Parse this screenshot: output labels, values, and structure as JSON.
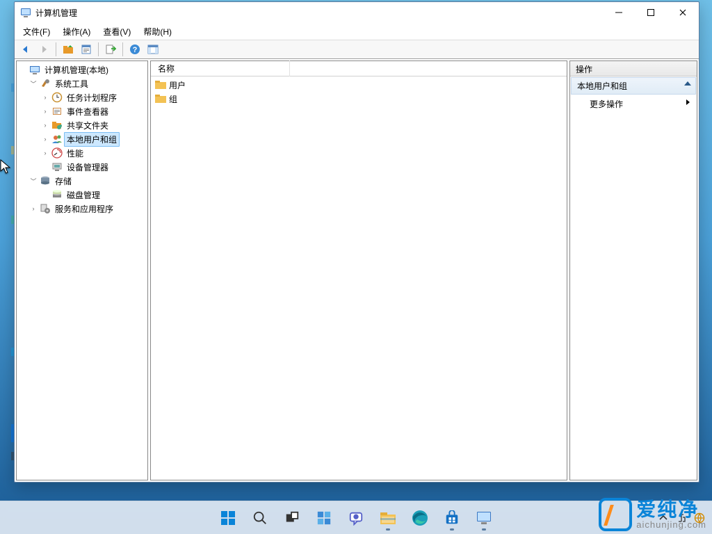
{
  "window": {
    "title": "计算机管理",
    "menus": {
      "file": "文件(F)",
      "action": "操作(A)",
      "view": "查看(V)",
      "help": "帮助(H)"
    }
  },
  "winctrl": {
    "min": "—",
    "max": "☐",
    "close": "✕"
  },
  "toolbar": {
    "back": "back",
    "fwd": "forward",
    "up": "up-folder",
    "props": "properties",
    "export": "export",
    "help": "help",
    "showhide": "showhide"
  },
  "tree": {
    "root": "计算机管理(本地)",
    "system_tools": "系统工具",
    "task_scheduler": "任务计划程序",
    "event_viewer": "事件查看器",
    "shared_folders": "共享文件夹",
    "local_users_groups": "本地用户和组",
    "performance": "性能",
    "device_manager": "设备管理器",
    "storage": "存储",
    "disk_mgmt": "磁盘管理",
    "services_apps": "服务和应用程序"
  },
  "content": {
    "column_name": "名称",
    "items": {
      "users": "用户",
      "groups": "组"
    }
  },
  "actions": {
    "header": "操作",
    "section": "本地用户和组",
    "more": "更多操作"
  },
  "watermark": {
    "cn": "爱纯净",
    "en": "aichunjing.com"
  }
}
